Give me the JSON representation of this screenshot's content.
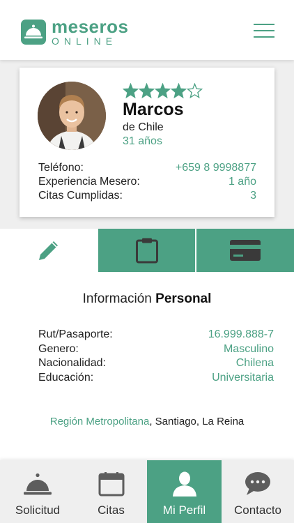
{
  "brand": {
    "name": "meseros",
    "tagline": "ONLINE"
  },
  "colors": {
    "accent": "#4ca184",
    "icon_gray": "#5d5d5d",
    "band": "#efefef"
  },
  "header": {
    "menu_icon": "hamburger-icon"
  },
  "profile": {
    "rating": 4,
    "rating_max": 5,
    "name": "Marcos",
    "origin": "de Chile",
    "age": "31 años",
    "stats": [
      {
        "label": "Teléfono:",
        "value": "+659 8 9998877"
      },
      {
        "label": "Experiencia Mesero:",
        "value": "1 año"
      },
      {
        "label": "Citas Cumplidas:",
        "value": "3"
      }
    ]
  },
  "tabs": [
    {
      "icon": "pencil-icon",
      "active": true
    },
    {
      "icon": "clipboard-icon",
      "active": false
    },
    {
      "icon": "credit-card-icon",
      "active": false
    }
  ],
  "section": {
    "title_regular": "Información",
    "title_bold": "Personal"
  },
  "info": [
    {
      "label": "Rut/Pasaporte:",
      "value": "16.999.888-7"
    },
    {
      "label": "Genero:",
      "value": "Masculino"
    },
    {
      "label": "Nacionalidad:",
      "value": "Chilena"
    },
    {
      "label": "Educación:",
      "value": "Universitaria"
    }
  ],
  "region": {
    "highlight": "Región Metropolitana",
    "rest": ", Santiago, La Reina"
  },
  "bottom_nav": [
    {
      "label": "Solicitud",
      "icon": "service-bell-icon",
      "active": false
    },
    {
      "label": "Citas",
      "icon": "calendar-icon",
      "active": false
    },
    {
      "label": "Mi Perfil",
      "icon": "user-icon",
      "active": true
    },
    {
      "label": "Contacto",
      "icon": "chat-bubble-icon",
      "active": false
    }
  ]
}
